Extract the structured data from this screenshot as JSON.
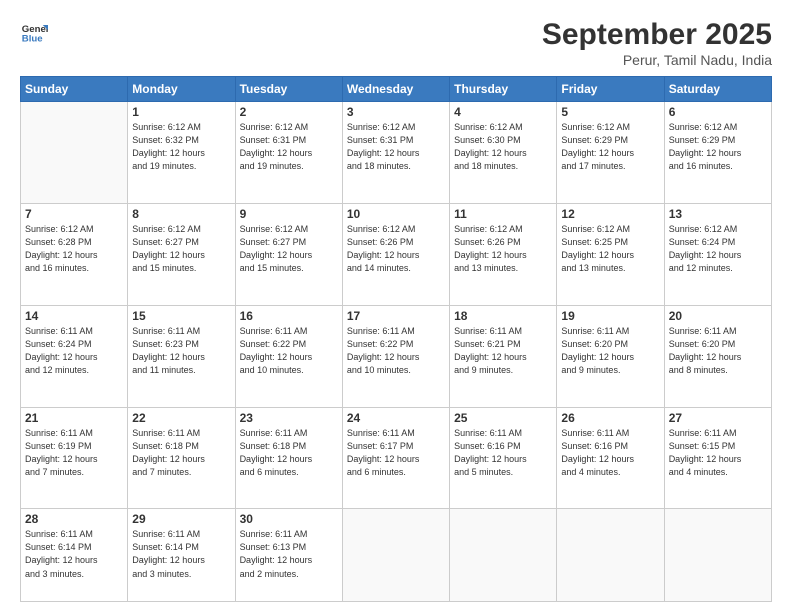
{
  "header": {
    "logo_line1": "General",
    "logo_line2": "Blue",
    "month": "September 2025",
    "location": "Perur, Tamil Nadu, India"
  },
  "weekdays": [
    "Sunday",
    "Monday",
    "Tuesday",
    "Wednesday",
    "Thursday",
    "Friday",
    "Saturday"
  ],
  "weeks": [
    [
      {
        "day": "",
        "info": ""
      },
      {
        "day": "1",
        "info": "Sunrise: 6:12 AM\nSunset: 6:32 PM\nDaylight: 12 hours\nand 19 minutes."
      },
      {
        "day": "2",
        "info": "Sunrise: 6:12 AM\nSunset: 6:31 PM\nDaylight: 12 hours\nand 19 minutes."
      },
      {
        "day": "3",
        "info": "Sunrise: 6:12 AM\nSunset: 6:31 PM\nDaylight: 12 hours\nand 18 minutes."
      },
      {
        "day": "4",
        "info": "Sunrise: 6:12 AM\nSunset: 6:30 PM\nDaylight: 12 hours\nand 18 minutes."
      },
      {
        "day": "5",
        "info": "Sunrise: 6:12 AM\nSunset: 6:29 PM\nDaylight: 12 hours\nand 17 minutes."
      },
      {
        "day": "6",
        "info": "Sunrise: 6:12 AM\nSunset: 6:29 PM\nDaylight: 12 hours\nand 16 minutes."
      }
    ],
    [
      {
        "day": "7",
        "info": "Sunrise: 6:12 AM\nSunset: 6:28 PM\nDaylight: 12 hours\nand 16 minutes."
      },
      {
        "day": "8",
        "info": "Sunrise: 6:12 AM\nSunset: 6:27 PM\nDaylight: 12 hours\nand 15 minutes."
      },
      {
        "day": "9",
        "info": "Sunrise: 6:12 AM\nSunset: 6:27 PM\nDaylight: 12 hours\nand 15 minutes."
      },
      {
        "day": "10",
        "info": "Sunrise: 6:12 AM\nSunset: 6:26 PM\nDaylight: 12 hours\nand 14 minutes."
      },
      {
        "day": "11",
        "info": "Sunrise: 6:12 AM\nSunset: 6:26 PM\nDaylight: 12 hours\nand 13 minutes."
      },
      {
        "day": "12",
        "info": "Sunrise: 6:12 AM\nSunset: 6:25 PM\nDaylight: 12 hours\nand 13 minutes."
      },
      {
        "day": "13",
        "info": "Sunrise: 6:12 AM\nSunset: 6:24 PM\nDaylight: 12 hours\nand 12 minutes."
      }
    ],
    [
      {
        "day": "14",
        "info": "Sunrise: 6:11 AM\nSunset: 6:24 PM\nDaylight: 12 hours\nand 12 minutes."
      },
      {
        "day": "15",
        "info": "Sunrise: 6:11 AM\nSunset: 6:23 PM\nDaylight: 12 hours\nand 11 minutes."
      },
      {
        "day": "16",
        "info": "Sunrise: 6:11 AM\nSunset: 6:22 PM\nDaylight: 12 hours\nand 10 minutes."
      },
      {
        "day": "17",
        "info": "Sunrise: 6:11 AM\nSunset: 6:22 PM\nDaylight: 12 hours\nand 10 minutes."
      },
      {
        "day": "18",
        "info": "Sunrise: 6:11 AM\nSunset: 6:21 PM\nDaylight: 12 hours\nand 9 minutes."
      },
      {
        "day": "19",
        "info": "Sunrise: 6:11 AM\nSunset: 6:20 PM\nDaylight: 12 hours\nand 9 minutes."
      },
      {
        "day": "20",
        "info": "Sunrise: 6:11 AM\nSunset: 6:20 PM\nDaylight: 12 hours\nand 8 minutes."
      }
    ],
    [
      {
        "day": "21",
        "info": "Sunrise: 6:11 AM\nSunset: 6:19 PM\nDaylight: 12 hours\nand 7 minutes."
      },
      {
        "day": "22",
        "info": "Sunrise: 6:11 AM\nSunset: 6:18 PM\nDaylight: 12 hours\nand 7 minutes."
      },
      {
        "day": "23",
        "info": "Sunrise: 6:11 AM\nSunset: 6:18 PM\nDaylight: 12 hours\nand 6 minutes."
      },
      {
        "day": "24",
        "info": "Sunrise: 6:11 AM\nSunset: 6:17 PM\nDaylight: 12 hours\nand 6 minutes."
      },
      {
        "day": "25",
        "info": "Sunrise: 6:11 AM\nSunset: 6:16 PM\nDaylight: 12 hours\nand 5 minutes."
      },
      {
        "day": "26",
        "info": "Sunrise: 6:11 AM\nSunset: 6:16 PM\nDaylight: 12 hours\nand 4 minutes."
      },
      {
        "day": "27",
        "info": "Sunrise: 6:11 AM\nSunset: 6:15 PM\nDaylight: 12 hours\nand 4 minutes."
      }
    ],
    [
      {
        "day": "28",
        "info": "Sunrise: 6:11 AM\nSunset: 6:14 PM\nDaylight: 12 hours\nand 3 minutes."
      },
      {
        "day": "29",
        "info": "Sunrise: 6:11 AM\nSunset: 6:14 PM\nDaylight: 12 hours\nand 3 minutes."
      },
      {
        "day": "30",
        "info": "Sunrise: 6:11 AM\nSunset: 6:13 PM\nDaylight: 12 hours\nand 2 minutes."
      },
      {
        "day": "",
        "info": ""
      },
      {
        "day": "",
        "info": ""
      },
      {
        "day": "",
        "info": ""
      },
      {
        "day": "",
        "info": ""
      }
    ]
  ]
}
